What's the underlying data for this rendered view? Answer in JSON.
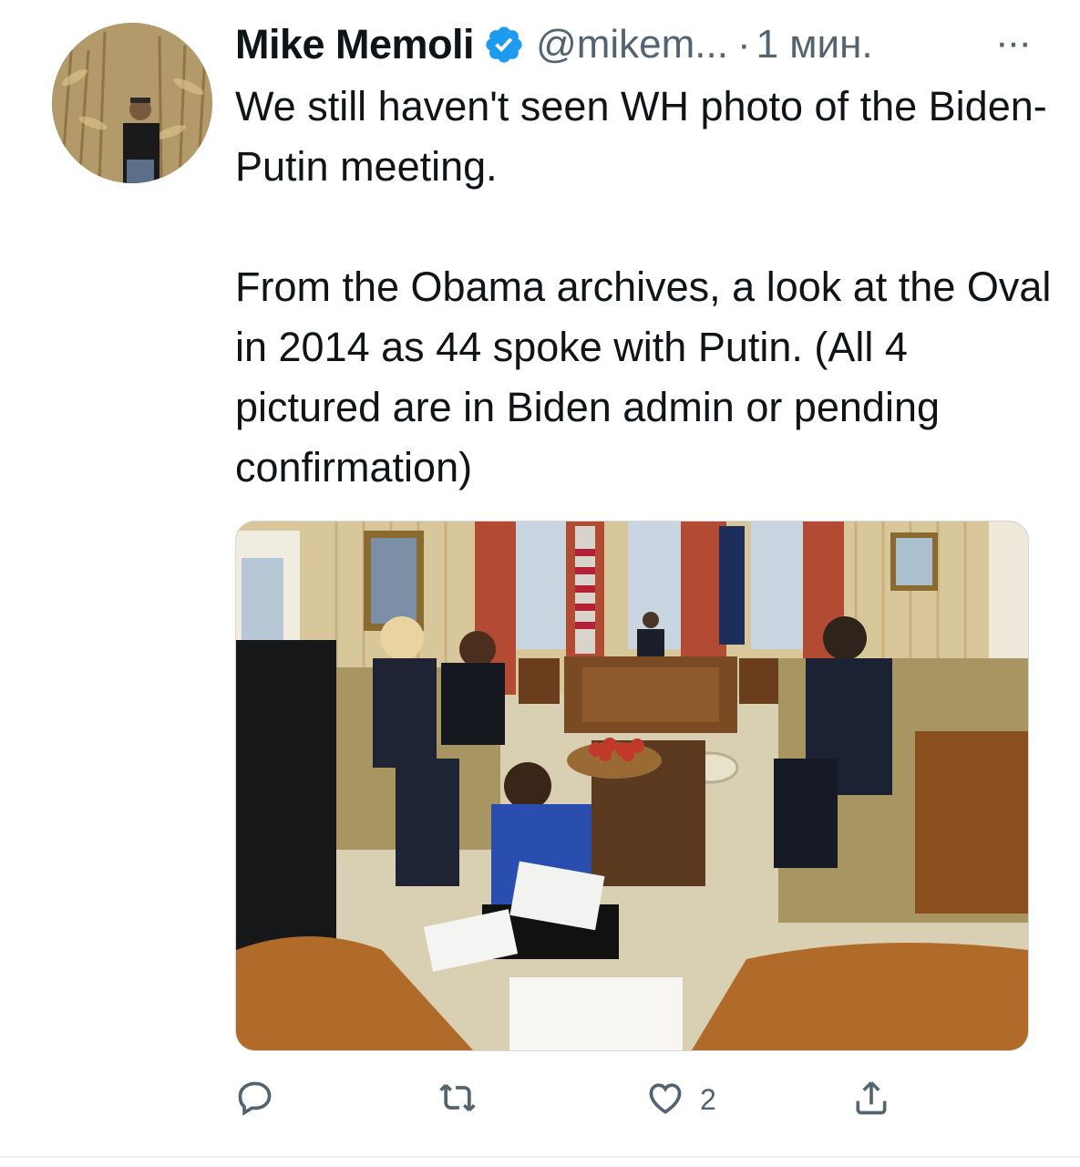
{
  "tweet": {
    "author_name": "Mike Memoli",
    "handle": "@mikem...",
    "separator": "·",
    "time": "1 мин.",
    "more": "···",
    "text_paragraph_1": "We still haven't seen WH photo of the Biden-Putin meeting.",
    "text_paragraph_2": "From the Obama archives, a look at the Oval in 2014 as 44 spoke with Putin. (All 4 pictured are in Biden admin or pending confirmation)"
  },
  "actions": {
    "reply_icon": "reply-icon",
    "retweet_icon": "retweet-icon",
    "like_icon": "heart-icon",
    "like_count": "2",
    "share_icon": "share-icon"
  },
  "colors": {
    "text_primary": "#0f1419",
    "text_secondary": "#536471",
    "verified_badge": "#1d9bf0"
  }
}
